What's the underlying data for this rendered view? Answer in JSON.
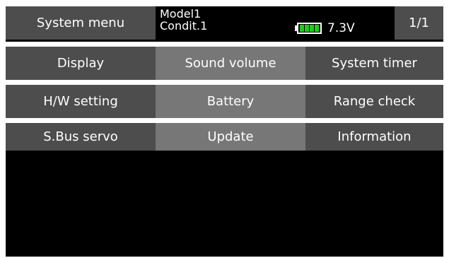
{
  "header": {
    "title": "System menu",
    "model": "Model1",
    "condition": "Condit.1",
    "voltage": "7.3V",
    "page": "1/1",
    "battery_icon": "battery-icon",
    "battery_color": "#22cc22"
  },
  "menu": {
    "rows": [
      [
        "Display",
        "Sound volume",
        "System timer"
      ],
      [
        "H/W setting",
        "Battery",
        "Range check"
      ],
      [
        "S.Bus servo",
        "Update",
        "Information"
      ]
    ]
  },
  "colors": {
    "background": "#000000",
    "cell_dark": "#4d4d4d",
    "cell_light": "#777777",
    "text": "#ffffff"
  }
}
